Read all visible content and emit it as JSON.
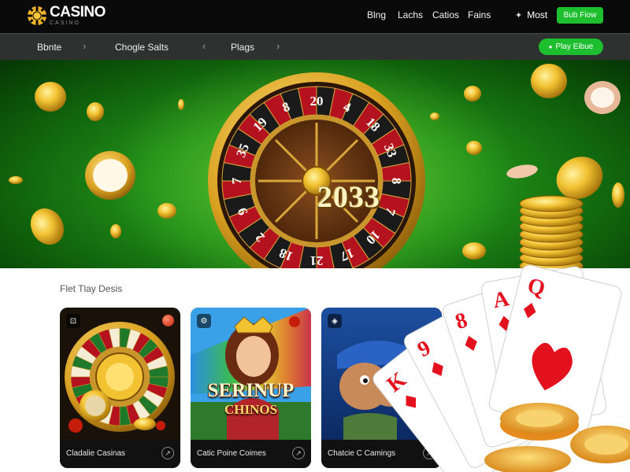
{
  "header": {
    "logo": {
      "name": "CASINO",
      "sub": "CASINO"
    },
    "nav": [
      "Blng",
      "Lachs",
      "Catios",
      "Fains"
    ],
    "most_label": "Most",
    "cta_label": "Bub Fiow"
  },
  "subnav": {
    "items": [
      "Bbnte",
      "Chogle Salts",
      "Plags"
    ],
    "cta_label": "Play Eibue"
  },
  "hero": {
    "year_text": "2033"
  },
  "section": {
    "title": "Flet Tlay Desis"
  },
  "cards": [
    {
      "label": "Cladalie Casinas",
      "badge": "⊡"
    },
    {
      "label": "Catic Poine Coimes",
      "badge": "⚙",
      "art_title": "SERINUP",
      "art_subtitle": "CHINOS"
    },
    {
      "label": "Chatcie C Camings",
      "badge": "◈"
    }
  ],
  "roulette_numbers": [
    "20",
    "4",
    "18",
    "33",
    "8",
    "7",
    "10",
    "17",
    "21",
    "18",
    "2",
    "9",
    "7",
    "35",
    "19",
    "8"
  ],
  "playing_cards": [
    "K",
    "9",
    "8",
    "A",
    "Q"
  ],
  "colors": {
    "accent_green": "#1dbf2e",
    "topbar": "#0a0a0a",
    "subbar": "#2f3130",
    "gold": "#f2c232",
    "card_red": "#e3101e"
  },
  "icons": {
    "logo": "casino-chip-icon",
    "most": "sparkle-icon",
    "chevron": "chevron-right-icon",
    "card_arrow": "arrow-up-right-icon"
  }
}
